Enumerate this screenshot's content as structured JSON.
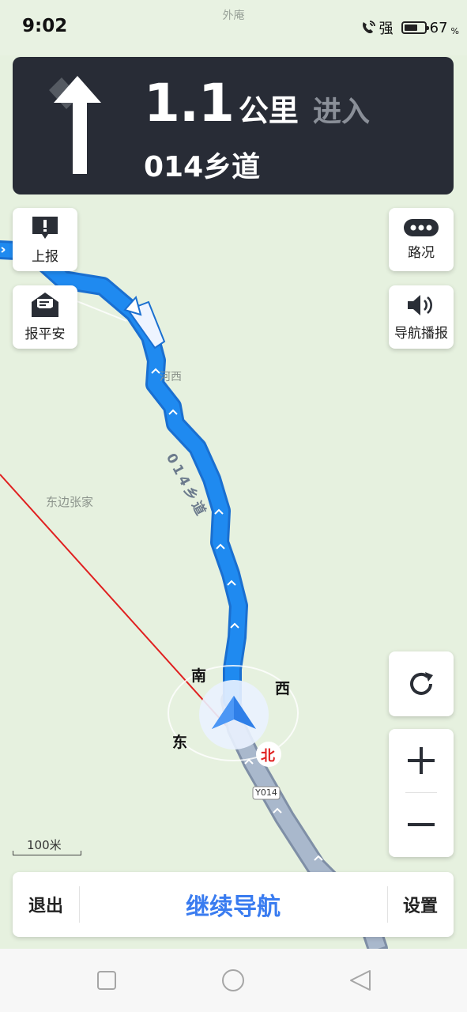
{
  "status": {
    "time": "9:02",
    "notice": "外庵",
    "signal": "强",
    "battery_percent": "67",
    "percent_sign": "%",
    "battery_level": 0.67
  },
  "guidance": {
    "distance": "1.1",
    "unit": "公里",
    "action": "进入",
    "road": "014乡道",
    "turn_icon": "arrow-straight-icon"
  },
  "map": {
    "places": {
      "hexi": "河西",
      "dongbian": "东边张家"
    },
    "route_label": "014乡道",
    "road_shield": "Y014",
    "compass": {
      "south": "南",
      "west": "西",
      "east": "东",
      "north": "北"
    },
    "scale": "100米"
  },
  "buttons": {
    "report": "上报",
    "safe": "报平安",
    "traffic": "路况",
    "voice": "导航播报"
  },
  "bottom": {
    "exit": "退出",
    "continue": "继续导航",
    "settings": "设置"
  },
  "colors": {
    "route_blue": "#1f8af0",
    "passed_gray": "#9fb0c2",
    "panel_dark": "#282c36",
    "accent": "#3a7cf0"
  }
}
